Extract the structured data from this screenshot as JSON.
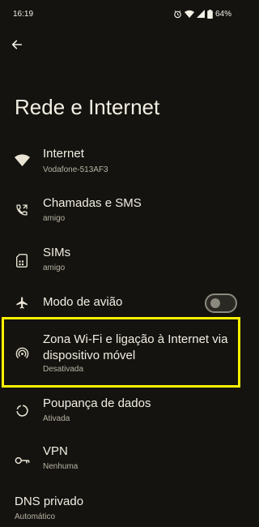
{
  "status_bar": {
    "time": "16:19",
    "battery": "64%",
    "icons": [
      "alarm-icon",
      "wifi-icon",
      "signal-icon",
      "battery-icon"
    ]
  },
  "header": {
    "back_icon": "arrow-back-icon",
    "title": "Rede e Internet"
  },
  "items": [
    {
      "name": "internet",
      "icon": "wifi-icon",
      "title": "Internet",
      "subtitle": "Vodafone-513AF3"
    },
    {
      "name": "calls-sms",
      "icon": "phone-forward-icon",
      "title": "Chamadas e SMS",
      "subtitle": "amigo"
    },
    {
      "name": "sims",
      "icon": "sim-card-icon",
      "title": "SIMs",
      "subtitle": "amigo"
    },
    {
      "name": "airplane-mode",
      "icon": "airplane-icon",
      "title": "Modo de avião",
      "toggle_on": false
    },
    {
      "name": "hotspot",
      "icon": "hotspot-icon",
      "title_line1": "Zona Wi-Fi e ligação à Internet via",
      "title_line2": "dispositivo móvel",
      "subtitle": "Desativada"
    },
    {
      "name": "data-saver",
      "icon": "data-saver-icon",
      "title": "Poupança de dados",
      "subtitle": "Ativada"
    },
    {
      "name": "vpn",
      "icon": "vpn-key-icon",
      "title": "VPN",
      "subtitle": "Nenhuma"
    },
    {
      "name": "private-dns",
      "title": "DNS privado",
      "subtitle": "Automático"
    }
  ],
  "colors": {
    "background": "#14130f",
    "highlight": "#fff000",
    "text_primary": "#f2eee3",
    "text_secondary": "#b7b2a4"
  }
}
